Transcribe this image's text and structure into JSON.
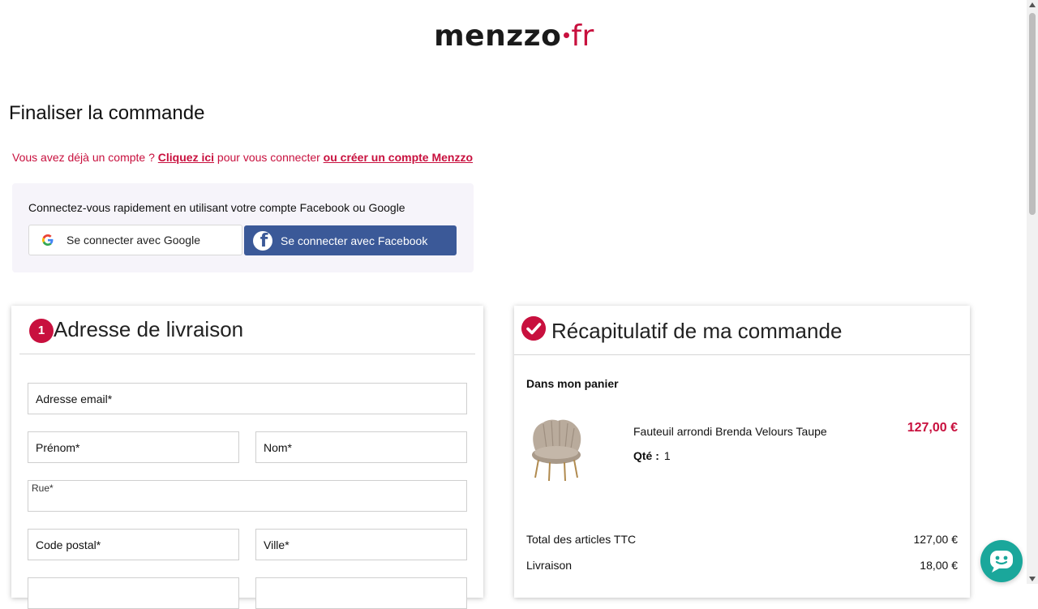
{
  "logo": {
    "name": "menzzo",
    "tld": "fr"
  },
  "page_title": "Finaliser la commande",
  "account": {
    "prefix": "Vous avez déjà un compte ?",
    "login_link": "Cliquez ici",
    "middle": "pour vous connecter",
    "create_link": "ou créer un compte Menzzo"
  },
  "social": {
    "intro": "Connectez-vous rapidement en utilisant votre compte Facebook ou Google",
    "google_label": "Se connecter avec Google",
    "facebook_label": "Se connecter avec Facebook"
  },
  "shipping": {
    "step": "1",
    "title": "Adresse de livraison",
    "email": "Adresse email*",
    "firstname": "Prénom*",
    "lastname": "Nom*",
    "street": "Rue*",
    "postcode": "Code postal*",
    "city": "Ville*"
  },
  "summary": {
    "title": "Récapitulatif de ma commande",
    "cart_label": "Dans mon panier",
    "product": {
      "name": "Fauteuil arrondi Brenda Velours Taupe",
      "qty_label": "Qté :",
      "qty": "1",
      "price": "127,00 €"
    },
    "total_label": "Total des articles TTC",
    "total_value": "127,00 €",
    "delivery_label": "Livraison",
    "delivery_value": "18,00 €"
  },
  "colors": {
    "brand": "#c8103e",
    "facebook": "#3b5998",
    "chat": "#1aa79b"
  },
  "icons": [
    "google-icon",
    "facebook-icon",
    "check-icon",
    "chat-icon"
  ]
}
